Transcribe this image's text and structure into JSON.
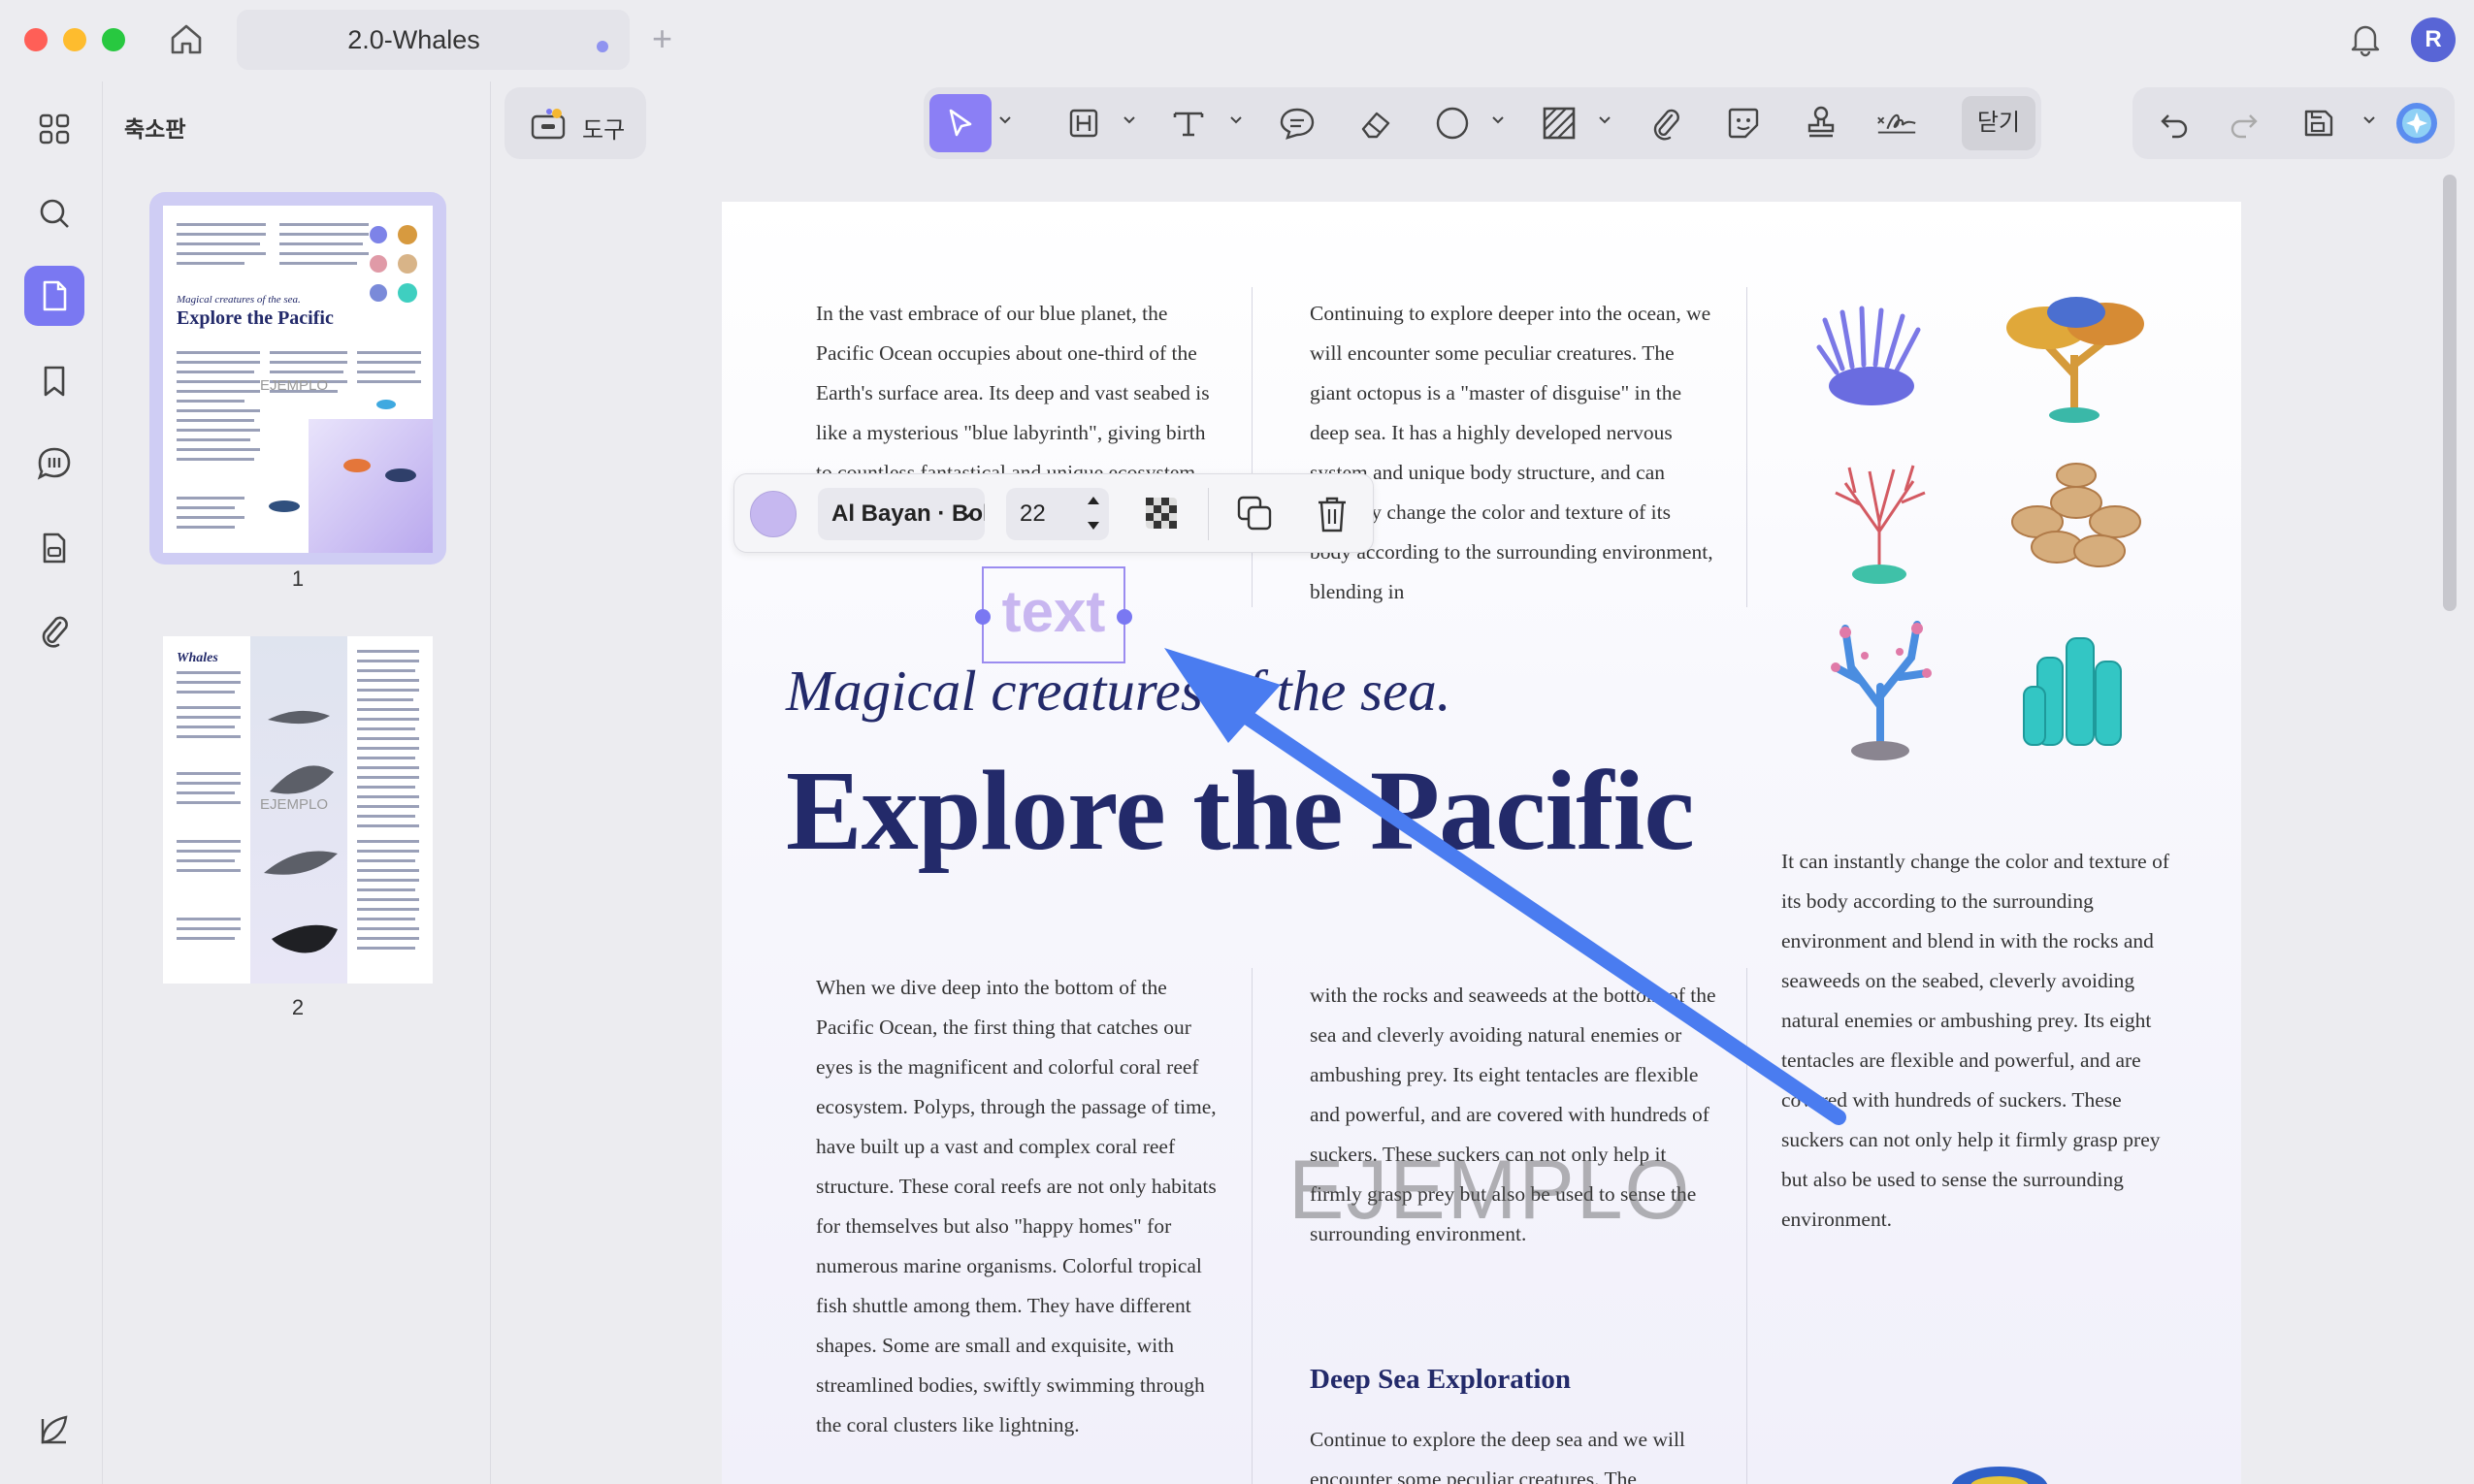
{
  "window": {
    "tab_title": "2.0-Whales",
    "new_tab": "+",
    "avatar_initial": "R"
  },
  "sidebar": {
    "panel_title": "축소판",
    "pages": [
      {
        "number": "1"
      },
      {
        "number": "2"
      }
    ]
  },
  "thumb1": {
    "subtitle": "Magical creatures of the sea.",
    "title": "Explore the Pacific",
    "watermark": "EJEMPLO"
  },
  "thumb2": {
    "title": "Whales",
    "watermark": "EJEMPLO"
  },
  "toolbar": {
    "tools_label": "도구",
    "close_label": "닫기"
  },
  "editbar": {
    "font": "Al Bayan · Bold",
    "size": "22",
    "color": "#c6b8f0"
  },
  "selected_text": "text",
  "document": {
    "col1_top": "In the vast embrace of our blue planet, the Pacific Ocean occupies about one-third of the Earth's surface area. Its deep and vast seabed is like a mysterious \"blue labyrinth\", giving birth to countless fantastical and unique ecosystem.",
    "col2_top": "Continuing to explore deeper into the ocean, we will encounter some peculiar creatures. The giant octopus is a \"master of disguise\" in the deep sea. It has a highly developed nervous system and unique body structure, and can instantly change the color and texture of its body according to the surrounding environment, blending in",
    "subtitle": "Magical creatures of the sea.",
    "headline": "Explore the Pacific",
    "col1_bottom": "When we dive deep into the bottom of the Pacific Ocean, the first thing that catches our eyes is the magnificent and colorful coral reef ecosystem. Polyps, through the passage of time, have built up a vast and complex coral reef structure. These coral reefs are not only habitats for themselves but also \"happy homes\" for numerous marine organisms. Colorful tropical fish shuttle among them. They have different shapes. Some are small and exquisite, with streamlined bodies, swiftly swimming through the coral clusters like lightning.",
    "col2_bottom": "with the rocks and seaweeds at the bottom of the sea and cleverly avoiding natural enemies or ambushing prey. Its eight tentacles are flexible and powerful, and are covered with hundreds of suckers. These suckers can not only help it firmly grasp prey but also be used to sense the surrounding environment.",
    "col3": "It can instantly change the color and texture of its body according to the surrounding environment and blend in with the rocks and seaweeds on the seabed, cleverly avoiding natural enemies or ambushing prey. Its eight tentacles are flexible and powerful, and are covered with hundreds of suckers. These suckers can not only help it firmly grasp prey but also be used to sense the surrounding environment.",
    "deep_heading": "Deep Sea Exploration",
    "deep_text": "Continue to explore the deep sea and we will encounter some peculiar creatures. The",
    "watermark": "EJEMPLO"
  },
  "colors": {
    "accent": "#7a78f2",
    "headline": "#232a6a",
    "arrow": "#4a7cf0"
  }
}
